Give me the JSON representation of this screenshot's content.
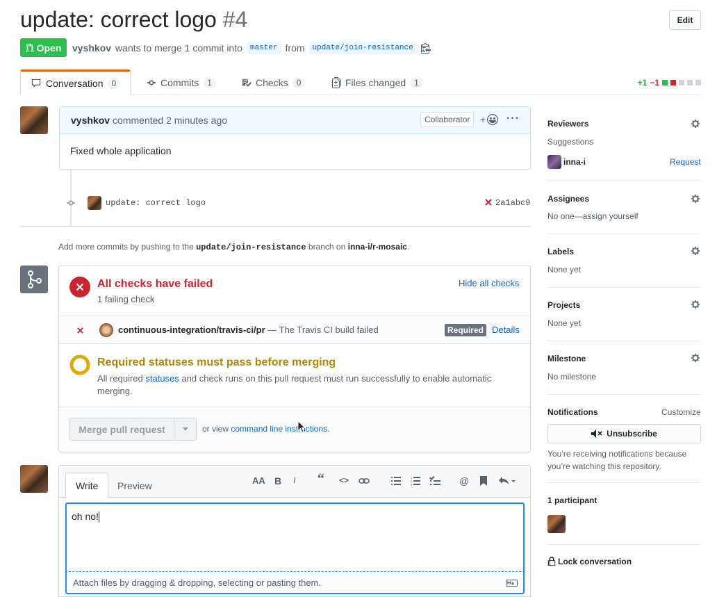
{
  "pr": {
    "title": "update: correct logo",
    "number": "#4",
    "edit_label": "Edit",
    "state": "Open",
    "author": "vyshkov",
    "meta_text": "wants to merge 1 commit into",
    "base_branch": "master",
    "from_text": "from",
    "head_branch": "update/join-resistance"
  },
  "tabs": [
    {
      "label": "Conversation",
      "count": "0"
    },
    {
      "label": "Commits",
      "count": "1"
    },
    {
      "label": "Checks",
      "count": "0"
    },
    {
      "label": "Files changed",
      "count": "1"
    }
  ],
  "diffstat": {
    "additions": "+1",
    "deletions": "−1"
  },
  "comment": {
    "author": "vyshkov",
    "action": "commented 2 minutes ago",
    "role_badge": "Collaborator",
    "reaction_label": "+",
    "body": "Fixed whole application"
  },
  "commit": {
    "message": "update: correct logo",
    "sha": "2a1abc9"
  },
  "push_hint": {
    "prefix": "Add more commits by pushing to the",
    "branch": "update/join-resistance",
    "middle": "branch on",
    "repo": "inna-i/r-mosaic",
    "suffix": "."
  },
  "checks": {
    "title": "All checks have failed",
    "subtitle": "1 failing check",
    "hide_label": "Hide all checks",
    "check_name": "continuous-integration/travis-ci/pr",
    "check_desc": "— The Travis CI build failed",
    "required_label": "Required",
    "details_label": "Details"
  },
  "required_status": {
    "title": "Required statuses must pass before merging",
    "text_before": "All required",
    "link": "statuses",
    "text_after": "and check runs on this pull request must run successfully to enable automatic",
    "text_line2": "merging."
  },
  "merge": {
    "button_label": "Merge pull request",
    "or_view": "or view",
    "cli_link": "command line instructions",
    "period": "."
  },
  "write": {
    "tab_write": "Write",
    "tab_preview": "Preview",
    "text": "oh no!",
    "attach_hint": "Attach files by dragging & dropping, selecting or pasting them."
  },
  "sidebar": {
    "reviewers_title": "Reviewers",
    "suggestions": "Suggestions",
    "reviewer_name": "inna-i",
    "request_label": "Request",
    "assignees_title": "Assignees",
    "assignees_text": "No one—assign yourself",
    "labels_title": "Labels",
    "labels_text": "None yet",
    "projects_title": "Projects",
    "projects_text": "None yet",
    "milestone_title": "Milestone",
    "milestone_text": "No milestone",
    "notifications_title": "Notifications",
    "customize_label": "Customize",
    "unsubscribe_label": "Unsubscribe",
    "notif_reason_1": "You’re receiving notifications because",
    "notif_reason_2": "you’re watching this repository.",
    "participants_title": "1 participant",
    "lock_label": "Lock conversation"
  },
  "colors": {
    "open_green": "#2cbe4e",
    "fail_red": "#cb2431",
    "pending_yellow": "#dbab09",
    "link_blue": "#0366d6"
  }
}
